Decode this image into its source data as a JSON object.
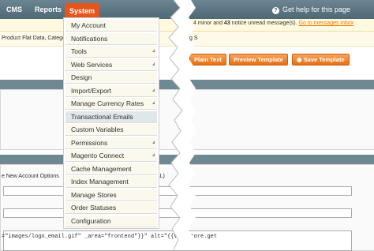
{
  "nav": {
    "items": [
      {
        "label": "CMS"
      },
      {
        "label": "Reports"
      },
      {
        "label": "System"
      }
    ],
    "help": "Get help for this page"
  },
  "notice": {
    "text_partial": "4 minor and",
    "count": "43",
    "text_after": "notice unread message(s).",
    "link": "Go to messages inbox"
  },
  "index_notice": {
    "left_text": "Product Flat Data, Catego",
    "right_text": "g S"
  },
  "buttons": {
    "plain_text": "Plain Text",
    "preview_template": "Preview Template",
    "save_template": "Save Template"
  },
  "form": {
    "subject_label": "e New Account Options",
    "subject_right": "AL)",
    "template_code": "=\"images/logo_email.gif\" _area=\"frontend\"}}\" alt=\"{{var store.get"
  },
  "system_menu": {
    "items": [
      {
        "label": "My Account",
        "arrow": false
      },
      {
        "label": "Notifications",
        "arrow": false
      },
      {
        "label": "Tools",
        "arrow": true
      },
      {
        "label": "Web Services",
        "arrow": true
      },
      {
        "label": "Design",
        "arrow": false
      },
      {
        "label": "Import/Export",
        "arrow": true
      },
      {
        "label": "Manage Currency Rates",
        "arrow": true
      },
      {
        "label": "Transactional Emails",
        "arrow": false
      },
      {
        "label": "Custom Variables",
        "arrow": false
      },
      {
        "label": "Permissions",
        "arrow": true
      },
      {
        "label": "Magento Connect",
        "arrow": true
      },
      {
        "label": "Cache Management",
        "arrow": false
      },
      {
        "label": "Index Management",
        "arrow": false
      },
      {
        "label": "Manage Stores",
        "arrow": false
      },
      {
        "label": "Order Statuses",
        "arrow": false
      },
      {
        "label": "Configuration",
        "arrow": false
      }
    ]
  },
  "colors": {
    "nav_bg": "#4e6875",
    "accent": "#e6561c",
    "menu_highlight": "#dfe7ea",
    "section_bar": "#6f8992"
  }
}
